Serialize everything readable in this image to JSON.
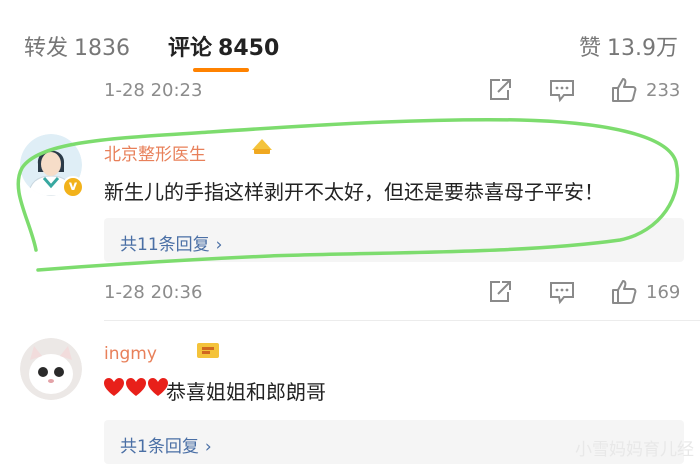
{
  "tabs": {
    "repost": {
      "label": "转发",
      "count": "1836"
    },
    "comments": {
      "label": "评论",
      "count": "8450"
    },
    "likes": {
      "label": "赞",
      "count": "13.9万"
    }
  },
  "rows": [
    {
      "time": "1-28 20:23",
      "likes": "233"
    },
    {
      "time": "1-28 20:36",
      "likes": "169"
    }
  ],
  "comments": [
    {
      "username": "北京整形医生",
      "text": "新生儿的手指这样剥开不太好，但还是要恭喜母子平安！",
      "reply_link": "共11条回复",
      "chevron": "›"
    },
    {
      "username": "ingmy",
      "text": "恭喜姐姐和郎朗哥",
      "reply_link": "共1条回复",
      "chevron": "›"
    }
  ],
  "annotation": {
    "color": "#7ddc6e"
  },
  "colors": {
    "accent": "#ff8200",
    "link": "#4a6fa5",
    "verified": "#f2b21b"
  },
  "watermark": "小雪妈妈育儿经"
}
